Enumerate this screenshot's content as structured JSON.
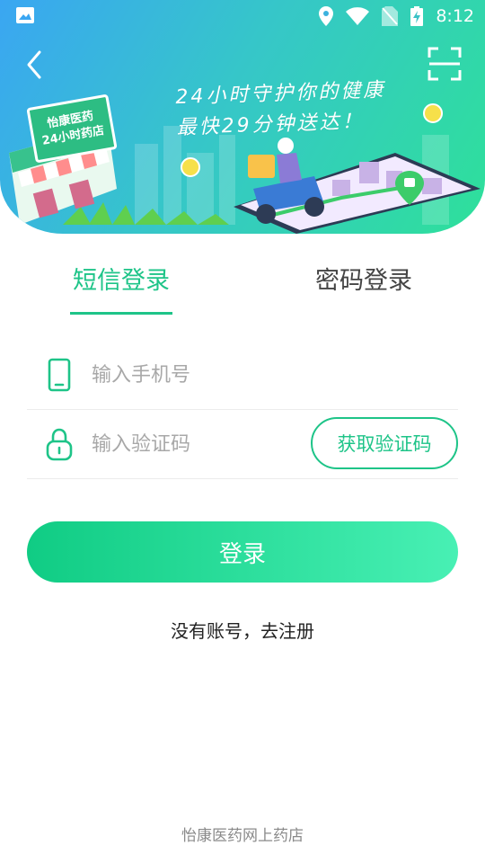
{
  "status_bar": {
    "time": "8:12",
    "icons": [
      "gallery-icon",
      "location-icon",
      "wifi-icon",
      "no-sim-icon",
      "battery-charging-icon"
    ]
  },
  "header": {
    "back_icon": "chevron-left-icon",
    "scan_icon": "scan-icon",
    "banner": {
      "slogan_line1": "24小时守护你的健康",
      "slogan_line2": "最快29分钟送达！",
      "store_sign_line1": "怡康医药",
      "store_sign_line2": "24小时药店"
    }
  },
  "tabs": [
    {
      "label": "短信登录",
      "active": true
    },
    {
      "label": "密码登录",
      "active": false
    }
  ],
  "form": {
    "phone_placeholder": "输入手机号",
    "phone_value": "",
    "code_placeholder": "输入验证码",
    "code_value": "",
    "get_code_label": "获取验证码"
  },
  "login_label": "登录",
  "register_text": "没有账号，去注册",
  "footer_text": "怡康医药网上药店",
  "colors": {
    "accent": "#1ec488",
    "button_gradient_start": "#10cc84",
    "button_gradient_end": "#48f0b4",
    "banner_start": "#3aa6f2",
    "banner_end": "#2ee09a"
  }
}
